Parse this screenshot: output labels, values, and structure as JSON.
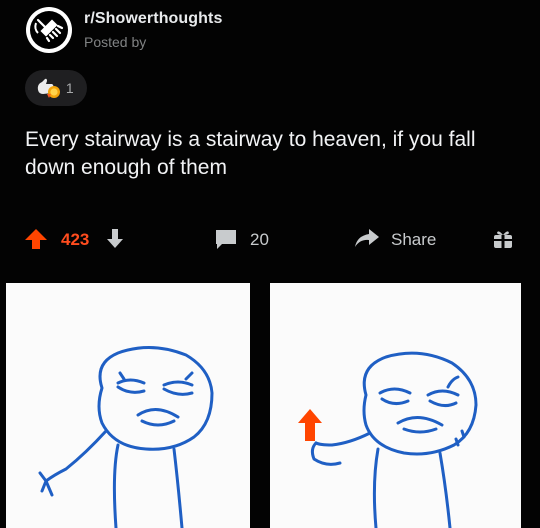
{
  "post": {
    "subreddit": "r/Showerthoughts",
    "posted_by": "Posted by",
    "award_count": "1",
    "title": "Every stairway is a stairway to heaven, if you fall down enough of them"
  },
  "actions": {
    "vote_count": "423",
    "comment_count": "20",
    "share_label": "Share"
  },
  "icons": {
    "subreddit": "shower-head-icon",
    "award": "award-icon",
    "upvote": "upvote-arrow-icon",
    "downvote": "downvote-arrow-icon",
    "comment": "comment-bubble-icon",
    "share": "share-arrow-icon",
    "gift": "gift-icon"
  },
  "colors": {
    "background": "#030303",
    "upvote": "#ff4500",
    "text": "#d7dadc",
    "muted": "#818384",
    "sketch_blue": "#1f5fc4"
  },
  "image": {
    "panels": 2,
    "description_icons": [
      "meme-left-panel",
      "meme-right-panel",
      "red-upvote-arrow-in-meme"
    ]
  }
}
